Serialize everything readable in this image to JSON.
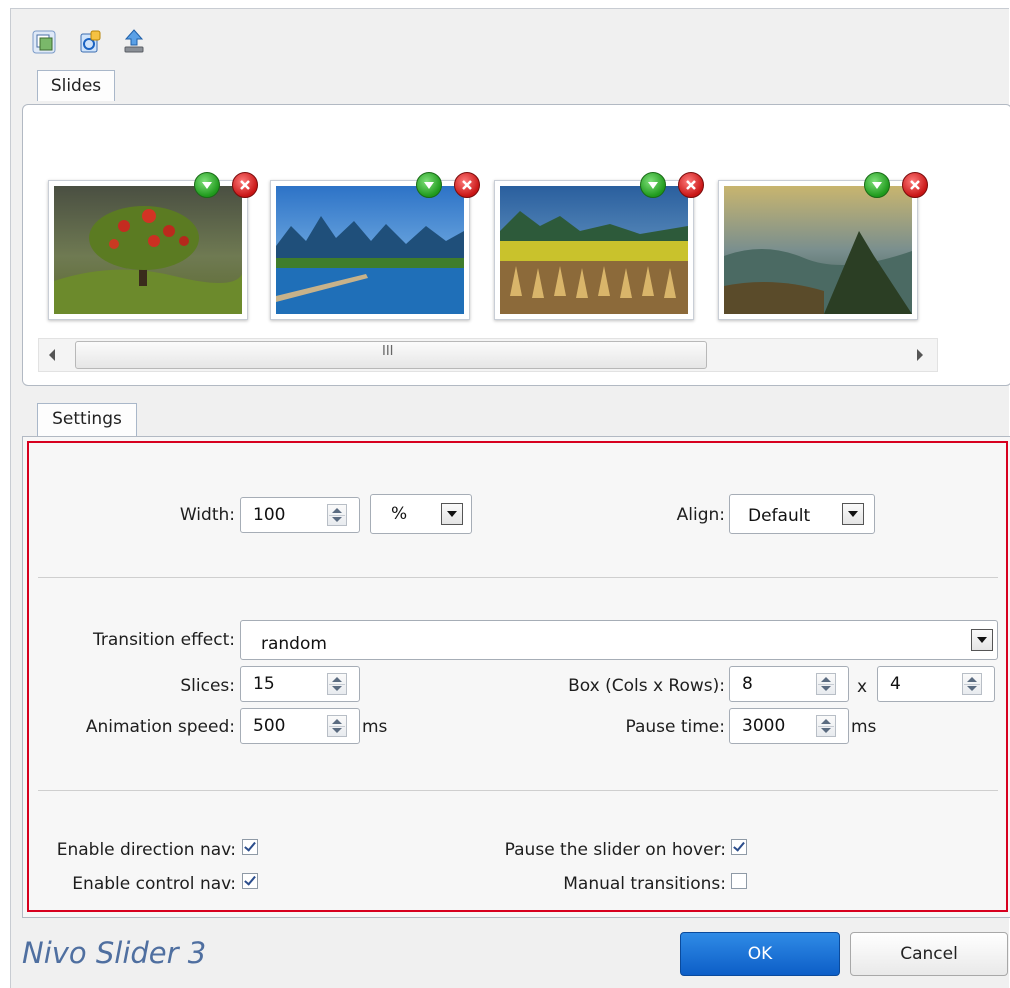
{
  "toolbar": {
    "icons": [
      "add-slides-icon",
      "refresh-images-icon",
      "upload-icon"
    ]
  },
  "slides": {
    "tab_label": "Slides",
    "thumbnails": [
      {
        "name": "red-tree"
      },
      {
        "name": "river-mountains"
      },
      {
        "name": "rice-field"
      },
      {
        "name": "mountain-valley"
      }
    ],
    "scroll_label": "III"
  },
  "settings": {
    "tab_label": "Settings",
    "width_label": "Width:",
    "width_value": "100",
    "unit_value": "%",
    "align_label": "Align:",
    "align_value": "Default",
    "transition_label": "Transition effect:",
    "transition_value": "random",
    "slices_label": "Slices:",
    "slices_value": "15",
    "box_label": "Box (Cols x Rows):",
    "box_cols": "8",
    "box_x": "x",
    "box_rows": "4",
    "anim_label": "Animation speed:",
    "anim_value": "500",
    "anim_unit": "ms",
    "pause_label": "Pause time:",
    "pause_value": "3000",
    "pause_unit": "ms",
    "dir_nav_label": "Enable direction nav:",
    "dir_nav_checked": true,
    "ctrl_nav_label": "Enable control nav:",
    "ctrl_nav_checked": true,
    "pause_hover_label": "Pause the slider on hover:",
    "pause_hover_checked": true,
    "manual_label": "Manual transitions:",
    "manual_checked": false
  },
  "footer": {
    "brand": "Nivo Slider 3",
    "ok_label": "OK",
    "cancel_label": "Cancel"
  },
  "colors": {
    "accent": "#0d5ec7",
    "highlight_frame": "#d7001f"
  }
}
